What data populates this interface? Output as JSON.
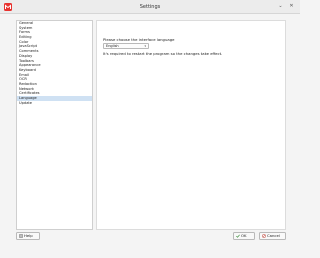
{
  "window": {
    "title": "Settings",
    "minimize_glyph": "⌄",
    "close_glyph": "✕"
  },
  "sidebar": {
    "items": [
      {
        "label": "General"
      },
      {
        "label": "System"
      },
      {
        "label": "Forms"
      },
      {
        "label": "Editing"
      },
      {
        "label": "Color"
      },
      {
        "label": "JavaScript"
      },
      {
        "label": "Comments"
      },
      {
        "label": "Display"
      },
      {
        "label": "Toolbars"
      },
      {
        "label": "Appearance"
      },
      {
        "label": "Keyboard"
      },
      {
        "label": "Email"
      },
      {
        "label": "OCR"
      },
      {
        "label": "Redaction"
      },
      {
        "label": "Network"
      },
      {
        "label": "Certificates"
      },
      {
        "label": "Language"
      },
      {
        "label": "Update"
      }
    ],
    "selected_index": 16
  },
  "language_page": {
    "prompt": "Please choose the interface language",
    "selected_language": "English",
    "chevron_glyph": "▾",
    "restart_note": "It's required to restart the program so the changes take effect."
  },
  "buttons": {
    "help": "Help",
    "ok": "OK",
    "cancel": "Cancel"
  },
  "colors": {
    "app_icon": "#e8322f",
    "selection": "#cfe1f3",
    "ok_check": "#3b8e3b",
    "cancel_x": "#c0392b"
  },
  "icons": {
    "app": "app-logo-icon",
    "help": "help-icon",
    "ok": "check-icon",
    "cancel": "cancel-icon"
  }
}
